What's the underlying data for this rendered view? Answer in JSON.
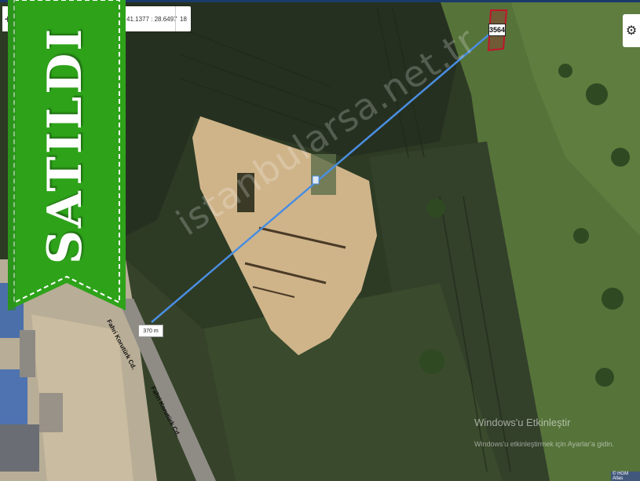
{
  "map": {
    "coordinates": "41.1377 : 28.6497",
    "zoom_level": "18",
    "zoom_in": "+",
    "settings_icon": "gear-icon",
    "parcel_label": "3564",
    "distance_label": "370 m",
    "road_labels": [
      "Fahri Korutürk Cd.",
      "Fahri Korutürk Cd."
    ],
    "watermark": "istanbularsa.net.tr",
    "attribution": "© HGM Atlas",
    "measure_line_color": "#4a8ee0",
    "parcel_color": "#c0152a"
  },
  "banner": {
    "text": "SATILDI",
    "color": "#2ea31a"
  },
  "windows_notice": {
    "title": "Windows'u Etkinleştir",
    "subtitle": "Windows'u etkinleştirmek için Ayarlar'a gidin."
  }
}
